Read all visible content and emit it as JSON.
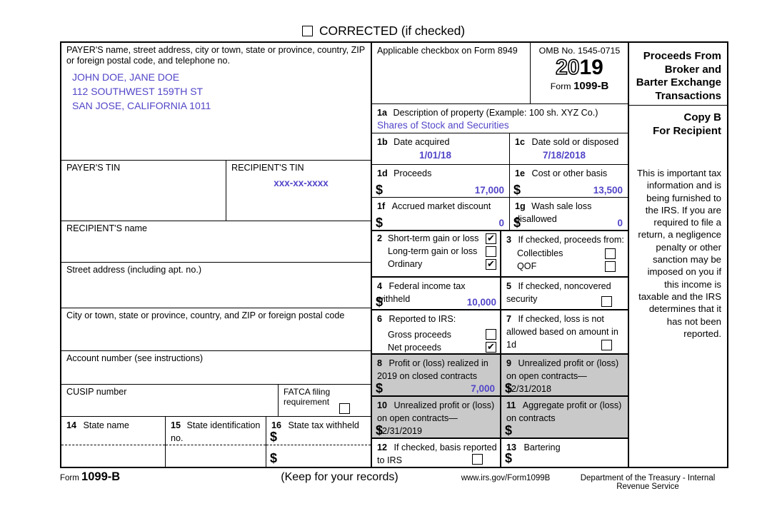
{
  "corrected": {
    "label": "CORRECTED (if checked)",
    "checked": false
  },
  "payer": {
    "label": "PAYER'S name, street address, city or town, state or province, country, ZIP or foreign postal code, and telephone no.",
    "lines": [
      "JOHN DOE, JANE DOE",
      "112 SOUTHWEST 159TH ST",
      "SAN JOSE, CALIFORNIA 1011"
    ]
  },
  "header": {
    "applicable_checkbox": "Applicable checkbox on Form 8949",
    "omb": "OMB No. 1545-0715",
    "year_outline": "20",
    "year_solid": "19",
    "form_word": "Form",
    "form_number": "1099-B",
    "title": "Proceeds From Broker and Barter Exchange Transactions"
  },
  "boxes": {
    "b1a": {
      "label": "1a Description of property (Example: 100 sh. XYZ Co.)",
      "num": "1a",
      "text": "Description of property (Example: 100 sh. XYZ Co.)",
      "value": "Shares of Stock and Securities"
    },
    "b1b": {
      "num": "1b",
      "text": "Date acquired",
      "value": "1/01/18"
    },
    "b1c": {
      "num": "1c",
      "text": "Date sold or disposed",
      "value": "7/18/2018"
    },
    "b1d": {
      "num": "1d",
      "text": "Proceeds",
      "value": "17,000"
    },
    "b1e": {
      "num": "1e",
      "text": "Cost or other basis",
      "value": "13,500"
    },
    "b1f": {
      "num": "1f",
      "text": "Accrued market discount",
      "value": "0"
    },
    "b1g": {
      "num": "1g",
      "text": "Wash sale loss disallowed",
      "value": "0"
    },
    "b2": {
      "num": "2",
      "options": [
        {
          "label": "Short-term gain or loss",
          "checked": true
        },
        {
          "label": "Long-term gain or loss",
          "checked": false
        },
        {
          "label": "Ordinary",
          "checked": true
        }
      ]
    },
    "b3": {
      "num": "3",
      "text": "If checked, proceeds from:",
      "options": [
        {
          "label": "Collectibles",
          "checked": false
        },
        {
          "label": "QOF",
          "checked": false
        }
      ]
    },
    "b4": {
      "num": "4",
      "text": "Federal income tax withheld",
      "value": "10,000"
    },
    "b5": {
      "num": "5",
      "text": "If checked, noncovered security",
      "checked": false
    },
    "b6": {
      "num": "6",
      "text": "Reported to IRS:",
      "options": [
        {
          "label": "Gross proceeds",
          "checked": false
        },
        {
          "label": "Net proceeds",
          "checked": true
        }
      ]
    },
    "b7": {
      "num": "7",
      "text": "If checked, loss is not allowed based on amount in 1d",
      "checked": false
    },
    "b8": {
      "num": "8",
      "text": "Profit or (loss) realized in 2019 on closed contracts",
      "value": "7,000"
    },
    "b9": {
      "num": "9",
      "text": "Unrealized profit or (loss) on open contracts—12/31/2018",
      "value": ""
    },
    "b10": {
      "num": "10",
      "text": "Unrealized profit or (loss) on open contracts—12/31/2019",
      "value": ""
    },
    "b11": {
      "num": "11",
      "text": "Aggregate profit or (loss) on contracts",
      "value": ""
    },
    "b12": {
      "num": "12",
      "text": "If checked, basis reported to IRS",
      "checked": false
    },
    "b13": {
      "num": "13",
      "text": "Bartering",
      "value": ""
    },
    "b14": {
      "num": "14",
      "text": "State name",
      "value1": "",
      "value2": ""
    },
    "b15": {
      "num": "15",
      "text": "State identification no.",
      "value1": "",
      "value2": ""
    },
    "b16": {
      "num": "16",
      "text": "State tax withheld",
      "value1": "",
      "value2": ""
    }
  },
  "left": {
    "payer_tin_label": "PAYER'S TIN",
    "payer_tin_value": "",
    "recipient_tin_label": "RECIPIENT'S TIN",
    "recipient_tin_value": "xxx-xx-xxxx",
    "recipient_name_label": "RECIPIENT'S name",
    "recipient_name_value": "",
    "street_label": "Street address (including apt. no.)",
    "street_value": "",
    "city_label": "City or town, state or province, country, and ZIP or foreign postal code",
    "city_value": "",
    "account_label": "Account number (see instructions)",
    "account_value": "",
    "cusip_label": "CUSIP number",
    "cusip_value": "",
    "fatca_label": "FATCA filing requirement",
    "fatca_checked": false
  },
  "right": {
    "copy": "Copy B",
    "for": "For Recipient",
    "notice": "This is important tax information and is being furnished to the IRS. If you are required to file a return, a negligence penalty or other sanction may be imposed on you if this income is taxable and the IRS determines that it has not been reported."
  },
  "footer": {
    "form_word": "Form",
    "form_number": "1099-B",
    "keep": "(Keep for your records)",
    "url": "www.irs.gov/Form1099B",
    "dept": "Department of the Treasury - Internal Revenue Service"
  },
  "colors": {
    "accent": "#5246c8",
    "shade": "#c9c9c9",
    "border": "#000000"
  }
}
